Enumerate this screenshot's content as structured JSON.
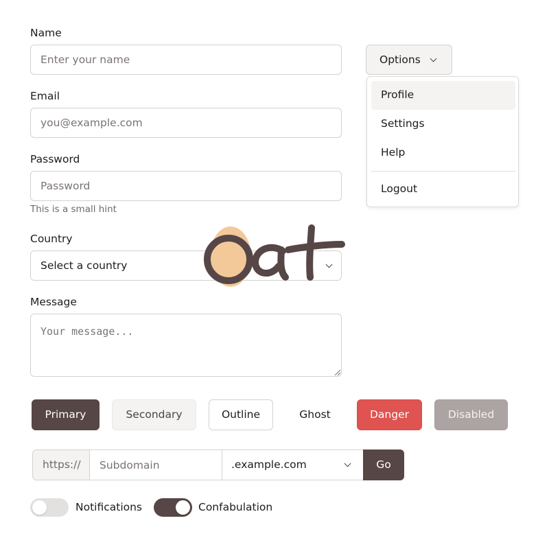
{
  "form": {
    "name": {
      "label": "Name",
      "placeholder": "Enter your name",
      "value": ""
    },
    "email": {
      "label": "Email",
      "placeholder": "you@example.com",
      "value": ""
    },
    "password": {
      "label": "Password",
      "placeholder": "Password",
      "value": "",
      "hint": "This is a small hint"
    },
    "country": {
      "label": "Country",
      "selected": "Select a country"
    },
    "message": {
      "label": "Message",
      "placeholder": "Your message...",
      "value": ""
    }
  },
  "options_menu": {
    "button_label": "Options",
    "items": [
      {
        "label": "Profile",
        "active": true
      },
      {
        "label": "Settings",
        "active": false
      },
      {
        "label": "Help",
        "active": false
      },
      {
        "label": "Logout",
        "active": false
      }
    ]
  },
  "buttons": {
    "primary": "Primary",
    "secondary": "Secondary",
    "outline": "Outline",
    "ghost": "Ghost",
    "danger": "Danger",
    "disabled": "Disabled"
  },
  "url_group": {
    "prefix": "https://",
    "subdomain_placeholder": "Subdomain",
    "subdomain_value": "",
    "domain_selected": ".example.com",
    "go_label": "Go"
  },
  "toggles": [
    {
      "label": "Notifications",
      "on": false
    },
    {
      "label": "Confabulation",
      "on": true
    }
  ],
  "colors": {
    "brand": "#574646",
    "danger": "#df5451",
    "disabled": "#aca4a3",
    "logo_accent": "#f3c99a",
    "logo_text": "#574646"
  },
  "icons": {
    "select_chevron": "chevron-down-icon",
    "resize_grip": "resize-grip-icon",
    "logo": "oat-logo"
  }
}
